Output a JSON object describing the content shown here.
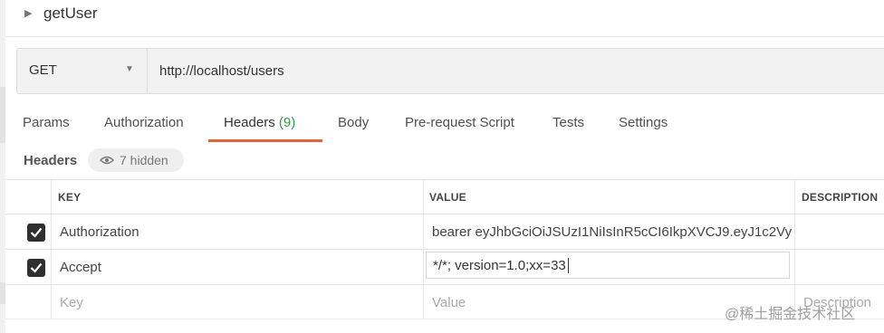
{
  "request": {
    "name": "getUser"
  },
  "url_bar": {
    "method": "GET",
    "url": "http://localhost/users"
  },
  "tabs": [
    {
      "label": "Params"
    },
    {
      "label": "Authorization"
    },
    {
      "label": "Headers",
      "count": "(9)",
      "active": true
    },
    {
      "label": "Body"
    },
    {
      "label": "Pre-request Script"
    },
    {
      "label": "Tests"
    },
    {
      "label": "Settings"
    }
  ],
  "headers_section": {
    "label": "Headers",
    "hidden_toggle": "7 hidden"
  },
  "table": {
    "columns": {
      "key": "KEY",
      "value": "VALUE",
      "description": "DESCRIPTION"
    },
    "rows": [
      {
        "checked": true,
        "key": "Authorization",
        "value": "bearer eyJhbGciOiJSUzI1NiIsInR5cCI6IkpXVCJ9.eyJ1c2Vy..."
      },
      {
        "checked": true,
        "key": "Accept",
        "value": "*/*; version=1.0;xx=33"
      }
    ],
    "new_row": {
      "key_placeholder": "Key",
      "value_placeholder": "Value",
      "description_placeholder": "Description"
    }
  },
  "watermark": "@稀土掘金技术社区",
  "colors": {
    "accent_underline": "#e2643f",
    "count_green": "#2e9a4e",
    "checkbox": "#2f2f2f"
  }
}
